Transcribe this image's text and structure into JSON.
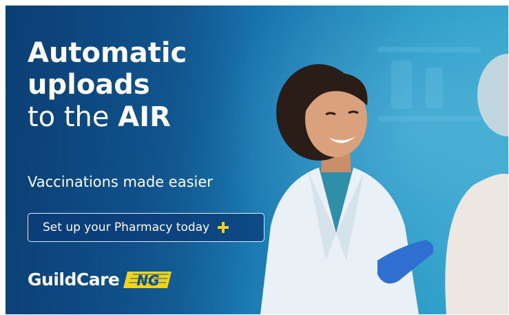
{
  "banner": {
    "headline": {
      "line1": "Automatic",
      "line2": "uploads",
      "line3_prefix": "to the ",
      "line3_bold": "AIR"
    },
    "subtitle": "Vaccinations made easier",
    "cta_label": "Set up your Pharmacy today",
    "cta_icon": "plus-icon",
    "logo": {
      "brand": "GuildCare",
      "suffix": "NG"
    },
    "colors": {
      "background": "#145f9c",
      "accent": "#f2d31b",
      "text": "#ffffff"
    }
  }
}
